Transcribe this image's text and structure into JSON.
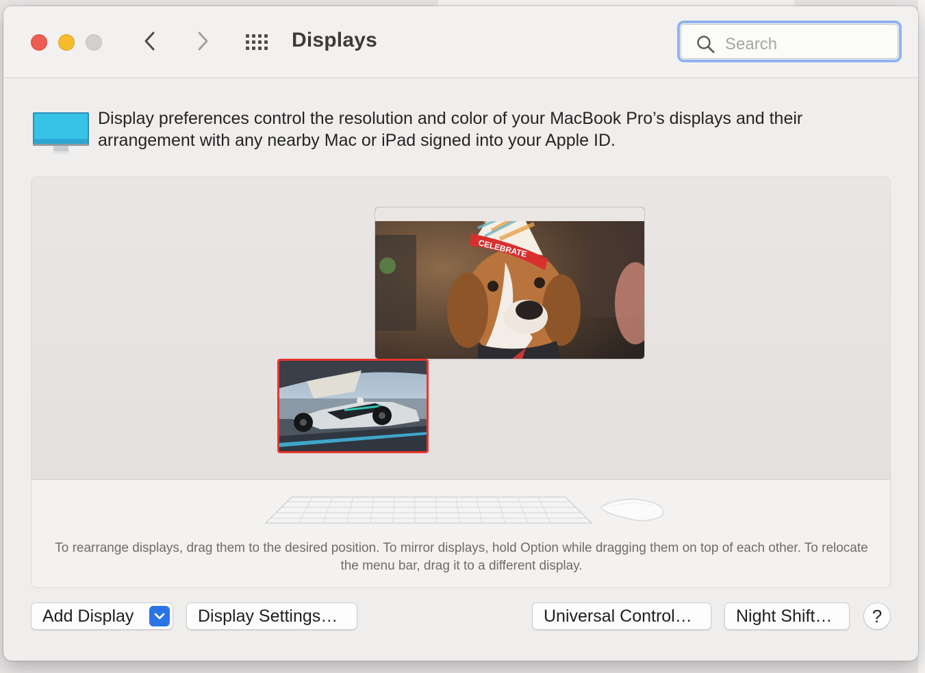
{
  "window": {
    "title": "Displays"
  },
  "toolbar": {
    "back_icon": "chevron-left-icon",
    "forward_icon": "chevron-right-icon",
    "grid_icon": "grid-icon"
  },
  "search": {
    "placeholder": "Search",
    "value": ""
  },
  "intro": {
    "icon": "monitor-icon",
    "text": "Display preferences control the resolution and color of your MacBook Pro’s displays and their arrangement with any nearby Mac or iPad signed into your Apple ID."
  },
  "arrangement": {
    "hint": "To rearrange displays, drag them to the desired position. To mirror displays, hold Option while dragging them on top of each other. To relocate the menu bar, drag it to a different display.",
    "main_display_wallpaper": "dog in party hat",
    "main_display_hat_text": "CELEBRATE",
    "second_display_wallpaper": "formula one race car",
    "selected_color": "#e8352c"
  },
  "buttons": {
    "add_display": "Add Display",
    "display_settings": "Display Settings…",
    "universal_control": "Universal Control…",
    "night_shift": "Night Shift…",
    "help": "?"
  },
  "colors": {
    "accent": "#2a74e6",
    "search_focus_ring": "#8fb3ee"
  }
}
